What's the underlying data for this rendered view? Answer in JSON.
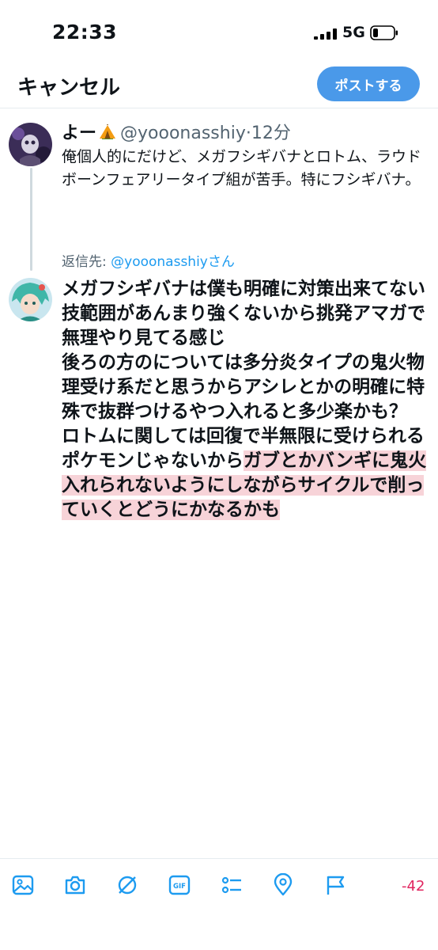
{
  "status": {
    "time": "22:33",
    "network": "5G"
  },
  "header": {
    "cancel_label": "キャンセル",
    "post_label": "ポストする"
  },
  "original_post": {
    "display_name": "よー",
    "name_emoji": "tent-icon",
    "handle": "@yooonasshiy",
    "separator": "·",
    "time_ago": "12分",
    "text": "俺個人的にだけど、メガフシギバナとロトム、ラウドボーンフェアリータイプ組が苦手。特にフシギバナ。"
  },
  "reply_to": {
    "prefix": "返信先: ",
    "handle": "@yooonasshiyさん"
  },
  "compose": {
    "text_within_limit": "メガフシギバナは僕も明確に対策出来てない\n技範囲があんまり強くないから挑発アマガで無理やり見てる感じ\n後ろの方のについては多分炎タイプの鬼火物理受け系だと思うからアシレとかの明確に特殊で抜群つけるやつ入れると多少楽かも？\nロトムに関しては回復で半無限に受けられるポケモンじゃないから",
    "text_over_limit": "ガブとかバンギに鬼火入れられないようにしながらサイクルで削っていくとどうにかなるかも"
  },
  "toolbar": {
    "icons": [
      "image-icon",
      "camera-icon",
      "gif-icon",
      "poll-icon",
      "location-icon",
      "flag-icon"
    ],
    "char_count": "-42"
  },
  "colors": {
    "accent": "#4a99e9",
    "over_limit_highlight": "#f7d3d8",
    "over_limit_count": "#e0245e"
  }
}
